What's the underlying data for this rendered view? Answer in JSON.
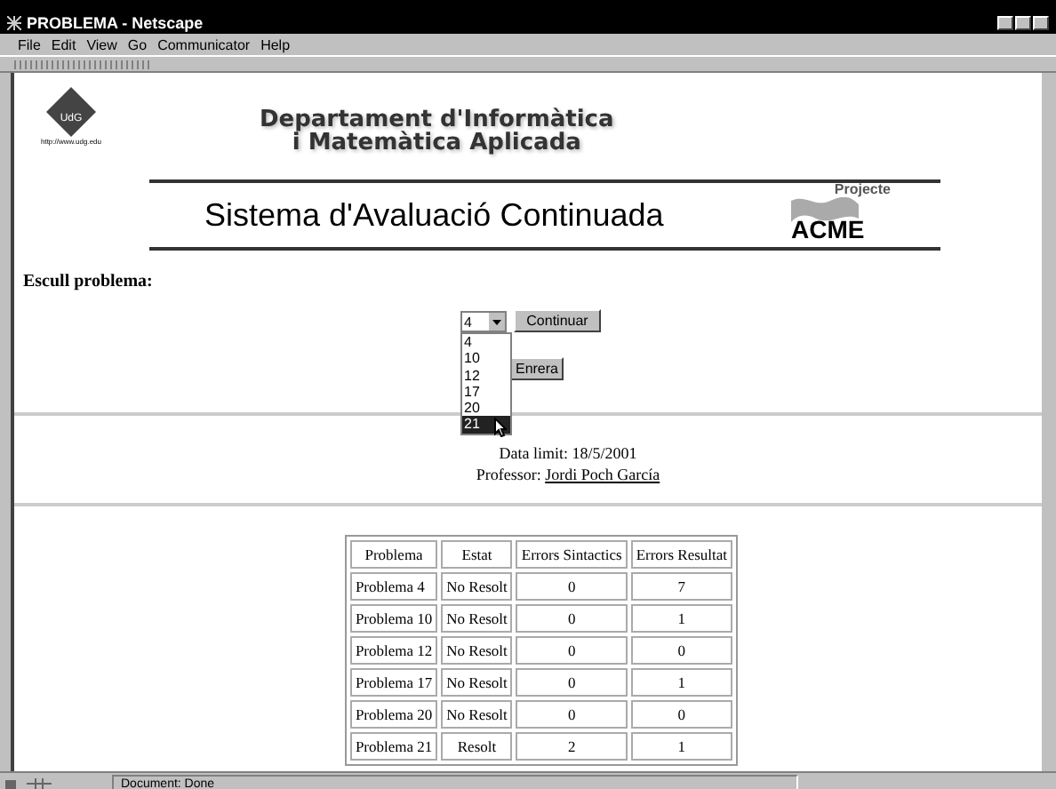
{
  "window": {
    "title": "PROBLEMA - Netscape"
  },
  "menu": [
    "File",
    "Edit",
    "View",
    "Go",
    "Communicator",
    "Help"
  ],
  "header": {
    "logo": "UdG",
    "logo_url": "http://www.udg.edu",
    "department": [
      "Departament d'Informàtica",
      "i Matemàtica Aplicada"
    ],
    "system_title": "Sistema d'Avaluació Continuada",
    "project_label": "Projecte",
    "project_name": "ACME"
  },
  "form": {
    "label": "Escull problema:",
    "select_value": "4",
    "options": [
      {
        "label": "4",
        "selected": false
      },
      {
        "label": "10",
        "selected": false
      },
      {
        "label": "12",
        "selected": false
      },
      {
        "label": "17",
        "selected": false
      },
      {
        "label": "20",
        "selected": false
      },
      {
        "label": "21",
        "selected": true
      }
    ],
    "continue_button": "Continuar",
    "back_button": "Enrera"
  },
  "info": {
    "deadline": "Data limit: 18/5/2001",
    "professor_label": "Professor:",
    "professor": "Jordi Poch García"
  },
  "table": {
    "columns": [
      "Problema",
      "Estat",
      "Errors Sintactics",
      "Errors Resultat"
    ],
    "rows": [
      [
        "Problema 4",
        "No Resolt",
        "0",
        "7"
      ],
      [
        "Problema 10",
        "No Resolt",
        "0",
        "1"
      ],
      [
        "Problema 12",
        "No Resolt",
        "0",
        "0"
      ],
      [
        "Problema 17",
        "No Resolt",
        "0",
        "1"
      ],
      [
        "Problema 20",
        "No Resolt",
        "0",
        "0"
      ],
      [
        "Problema 21",
        "Resolt",
        "2",
        "1"
      ]
    ]
  },
  "status_bar": {
    "text": "Document: Done"
  }
}
